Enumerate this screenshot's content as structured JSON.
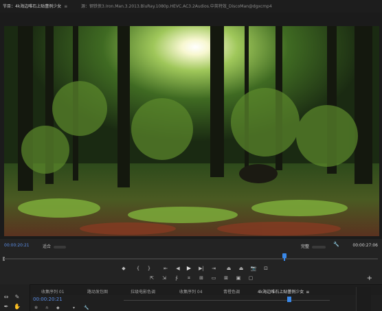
{
  "titlebar": {
    "tab1_label": "节目：4k海边唯石上贴蕾例少女",
    "tab1_menu": "≡",
    "tab2_label": "源：钢铁侠3.Iron.Man.3.2013.BluRay.1080p.HEVC.AC3.2Audios.中英特效_DiscoMan@dgxcmp4"
  },
  "monitor": {
    "timecode_left": "00:00:20:21",
    "fit_label": "适合",
    "quality_label": "完整",
    "timecode_right": "00:00:27:06",
    "playhead_fraction": 0.75
  },
  "timeline": {
    "tabs": [
      {
        "label": "收集序列 01"
      },
      {
        "label": "路动发包图"
      },
      {
        "label": "拉级电影色调"
      },
      {
        "label": "收集序列 04"
      },
      {
        "label": "青橙色调"
      },
      {
        "label": "4k海边唯石上贴蕾例少女",
        "menu": "≡"
      }
    ],
    "timecode": "00:00:20:21"
  },
  "colors": {
    "accent": "#3a88e8",
    "timecode": "#5b8ee6",
    "panel": "#232323"
  }
}
